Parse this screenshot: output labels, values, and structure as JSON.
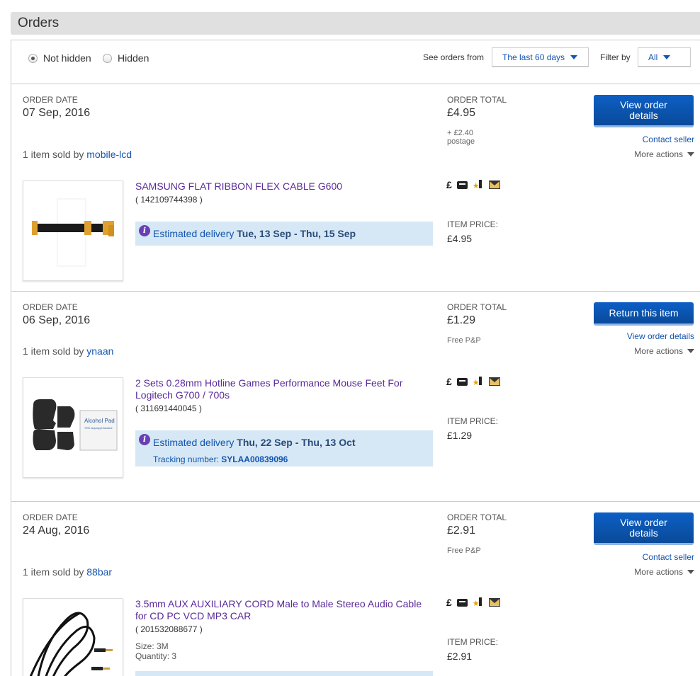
{
  "page": {
    "title": "Orders"
  },
  "filters": {
    "not_hidden_label": "Not hidden",
    "hidden_label": "Hidden",
    "see_orders_label": "See orders from",
    "period_value": "The last 60 days",
    "filter_by_label": "Filter by",
    "filter_value": "All"
  },
  "labels": {
    "order_date": "ORDER DATE",
    "order_total": "ORDER TOTAL",
    "item_price": "ITEM PRICE:",
    "more_actions": "More actions",
    "item_sold_by": "1 item sold by",
    "estimated_delivery": "Estimated delivery",
    "tracking_number": "Tracking number:"
  },
  "colors": {
    "primary_button": "#0c5fc5",
    "link": "#1254b0",
    "item_title": "#5a2a9a",
    "delivery_bg": "#d6e8f5"
  },
  "orders": [
    {
      "date": "07 Sep, 2016",
      "total": "£4.95",
      "postage_line1": "+ £2.40",
      "postage_line2": "postage",
      "seller": "mobile-lcd",
      "primary_button": "View order details",
      "secondary_link": "Contact seller",
      "item_title": "SAMSUNG FLAT RIBBON FLEX CABLE G600",
      "item_id": "( 142109744398 )",
      "delivery_dates": "Tue, 13 Sep - Thu, 15 Sep",
      "item_price": "£4.95"
    },
    {
      "date": "06 Sep, 2016",
      "total": "£1.29",
      "postage_line1": "Free P&P",
      "seller": "ynaan",
      "primary_button": "Return this item",
      "secondary_link": "View order details",
      "item_title": "2 Sets 0.28mm Hotline Games Performance Mouse Feet For Logitech G700 / 700s",
      "item_id": "( 311691440045 )",
      "delivery_dates": "Thu, 22 Sep - Thu, 13 Oct",
      "tracking": "SYLAA00839096",
      "item_price": "£1.29",
      "thumb_text1": "Alcohol Pad",
      "thumb_text2": "70% Isopropyl Alcohol"
    },
    {
      "date": "24 Aug, 2016",
      "total": "£2.91",
      "postage_line1": "Free P&P",
      "seller": "88bar",
      "primary_button": "View order details",
      "secondary_link": "Contact seller",
      "item_title": "3.5mm AUX AUXILIARY CORD Male to Male Stereo Audio Cable for CD PC VCD MP3 CAR",
      "item_id": "( 201532088677 )",
      "size": "Size: 3M",
      "quantity": "Quantity: 3",
      "item_price": "£2.91"
    }
  ]
}
